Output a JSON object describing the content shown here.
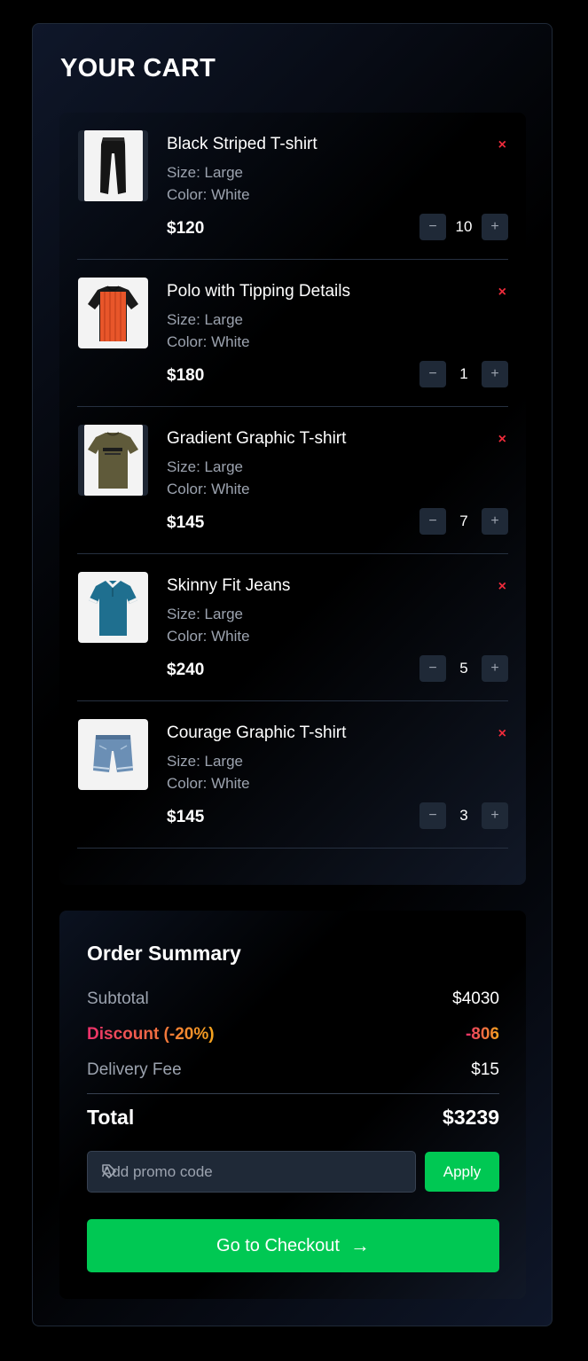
{
  "cart": {
    "title": "YOUR CART",
    "remove_symbol": "×",
    "minus_symbol": "−",
    "plus_symbol": "+",
    "items": [
      {
        "name": "Black Striped T-shirt",
        "size": "Size: Large",
        "color": "Color: White",
        "price": "$120",
        "quantity": "10",
        "image": "black-pants-image"
      },
      {
        "name": "Polo with Tipping Details",
        "size": "Size: Large",
        "color": "Color: White",
        "price": "$180",
        "quantity": "1",
        "image": "orange-tshirt-image"
      },
      {
        "name": "Gradient Graphic T-shirt",
        "size": "Size: Large",
        "color": "Color: White",
        "price": "$145",
        "quantity": "7",
        "image": "olive-graphic-tshirt-image"
      },
      {
        "name": "Skinny Fit Jeans",
        "size": "Size: Large",
        "color": "Color: White",
        "price": "$240",
        "quantity": "5",
        "image": "teal-polo-image"
      },
      {
        "name": "Courage Graphic T-shirt",
        "size": "Size: Large",
        "color": "Color: White",
        "price": "$145",
        "quantity": "3",
        "image": "denim-shorts-image"
      }
    ]
  },
  "summary": {
    "title": "Order Summary",
    "subtotal_label": "Subtotal",
    "subtotal_value": "$4030",
    "discount_label": "Discount (-20%)",
    "discount_value": "-806",
    "delivery_label": "Delivery Fee",
    "delivery_value": "$15",
    "total_label": "Total",
    "total_value": "$3239",
    "promo_placeholder": "Add promo code",
    "promo_icon": "tag-icon",
    "apply_label": "Apply",
    "checkout_label": "Go to Checkout",
    "checkout_arrow": "→"
  },
  "colors": {
    "accent_green": "#00c853",
    "remove_red": "#ef2b3b",
    "discount_gradient": [
      "#ec2f6b",
      "#f6a51d"
    ],
    "muted_text": "#9ca3af"
  }
}
